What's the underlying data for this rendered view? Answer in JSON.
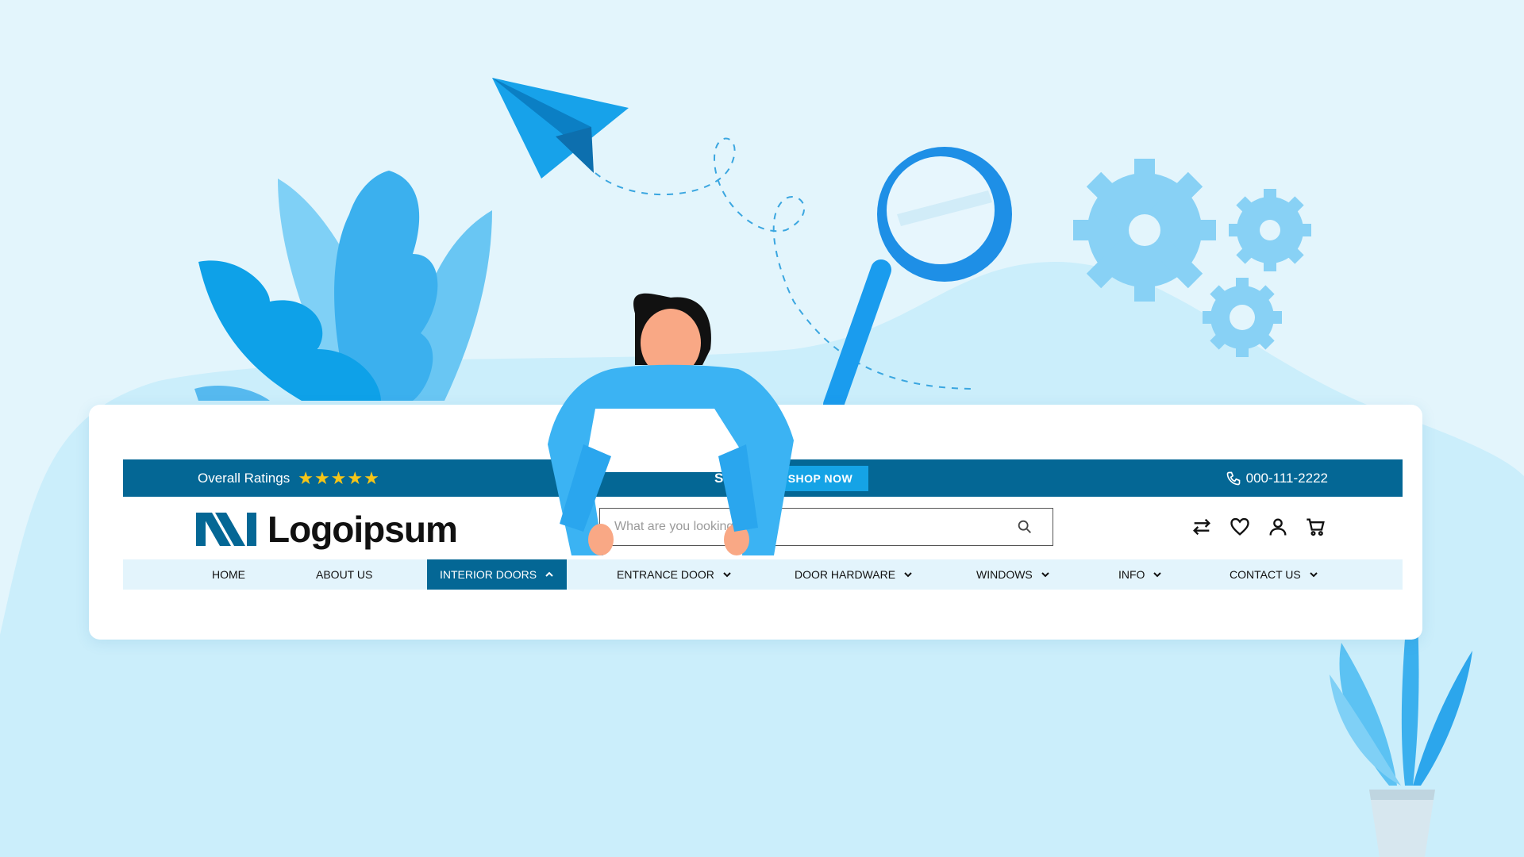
{
  "topbar": {
    "ratings_label": "Overall Ratings",
    "stars": "★★★★★",
    "sale_text": "Sale",
    "sale_suffix": "e",
    "shop_button": "SHOP NOW",
    "phone": "000-111-2222"
  },
  "header": {
    "logo_text": "Logoipsum",
    "search_placeholder": "What are you looking for",
    "icons": [
      "swap-icon",
      "heart-icon",
      "user-icon",
      "cart-icon"
    ]
  },
  "nav": {
    "items": [
      {
        "label": "HOME"
      },
      {
        "label": "ABOUT US"
      },
      {
        "label": "INTERIOR DOORS"
      },
      {
        "label": "ENTRANCE DOOR"
      },
      {
        "label": "DOOR HARDWARE"
      },
      {
        "label": "WINDOWS"
      },
      {
        "label": "INFO"
      },
      {
        "label": "CONTACT US"
      }
    ]
  },
  "colors": {
    "primary": "#046795",
    "accent": "#15a3e6",
    "background": "#e3f5fc",
    "nav_background": "#e3f4fc",
    "star": "#f5c518"
  }
}
